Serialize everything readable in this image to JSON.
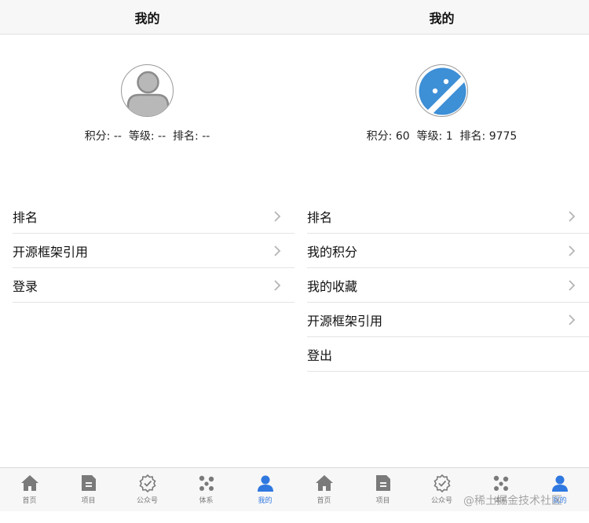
{
  "screens": [
    {
      "nav_title": "我的",
      "avatar": "default-user-avatar",
      "stats_text": "积分: --  等级: --  排名: --",
      "menu": [
        {
          "label": "排名",
          "chevron": true
        },
        {
          "label": "开源框架引用",
          "chevron": true
        },
        {
          "label": "登录",
          "chevron": true
        }
      ],
      "tabs": [
        {
          "label": "首页",
          "icon": "home-icon",
          "active": false
        },
        {
          "label": "项目",
          "icon": "project-icon",
          "active": false
        },
        {
          "label": "公众号",
          "icon": "badge-check-icon",
          "active": false
        },
        {
          "label": "体系",
          "icon": "system-nodes-icon",
          "active": false
        },
        {
          "label": "我的",
          "icon": "user-icon",
          "active": true
        }
      ]
    },
    {
      "nav_title": "我的",
      "avatar": "android-avatar",
      "stats_text": "积分: 60  等级: 1  排名: 9775",
      "menu": [
        {
          "label": "排名",
          "chevron": true
        },
        {
          "label": "我的积分",
          "chevron": true
        },
        {
          "label": "我的收藏",
          "chevron": true
        },
        {
          "label": "开源框架引用",
          "chevron": true
        },
        {
          "label": "登出",
          "chevron": false
        }
      ],
      "tabs": [
        {
          "label": "首页",
          "icon": "home-icon",
          "active": false
        },
        {
          "label": "项目",
          "icon": "project-icon",
          "active": false
        },
        {
          "label": "公众号",
          "icon": "badge-check-icon",
          "active": false
        },
        {
          "label": "体系",
          "icon": "system-nodes-icon",
          "active": false
        },
        {
          "label": "我的",
          "icon": "user-icon",
          "active": true
        }
      ]
    }
  ],
  "colors": {
    "active": "#2f78e0",
    "inactive": "#7a7a7a",
    "android_avatar": "#3d8fd6"
  },
  "watermark": "@稀土掘金技术社区"
}
